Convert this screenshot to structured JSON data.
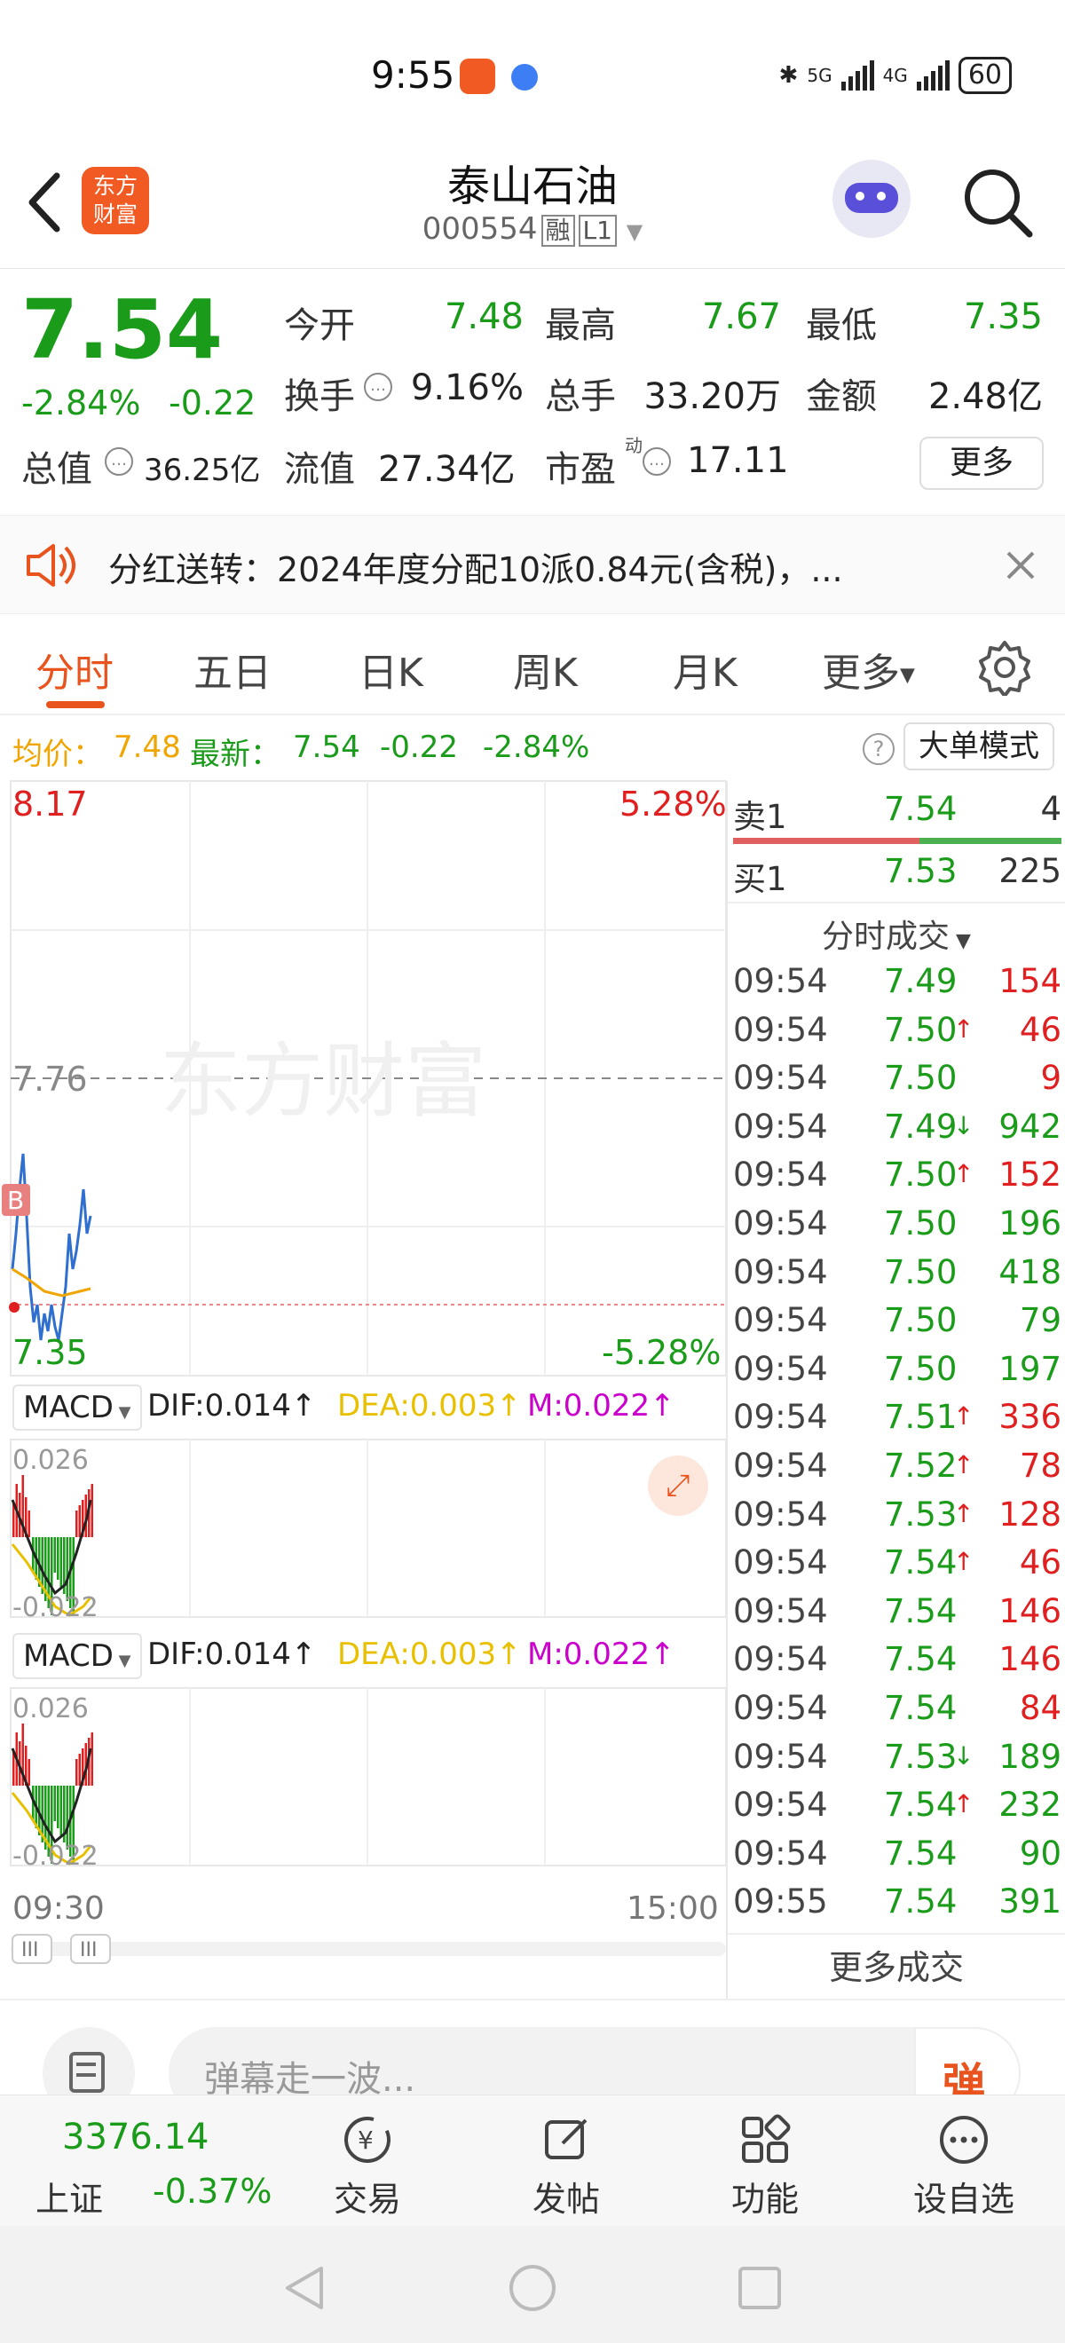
{
  "status_bar": {
    "time": "9:55",
    "network1": "5G",
    "network2": "4G",
    "battery": "60"
  },
  "header": {
    "title": "泰山石油",
    "code": "000554",
    "tag1": "融",
    "tag2": "L1",
    "logo_line1": "东方",
    "logo_line2": "财富"
  },
  "quote": {
    "price": "7.54",
    "change_pct": "-2.84%",
    "change": "-0.22",
    "open_label": "今开",
    "open": "7.48",
    "high_label": "最高",
    "high": "7.67",
    "low_label": "最低",
    "low": "7.35",
    "turnover_label": "换手",
    "turnover": "9.16%",
    "volume_label": "总手",
    "volume": "33.20万",
    "amount_label": "金额",
    "amount": "2.48亿",
    "mktcap_label": "总值",
    "mktcap": "36.25亿",
    "float_label": "流值",
    "float_cap": "27.34亿",
    "pe_label": "市盈",
    "pe_sup": "动",
    "pe": "17.11",
    "more": "更多"
  },
  "notice": {
    "text": "分红送转：2024年度分配10派0.84元(含税)，..."
  },
  "tabs": [
    "分时",
    "五日",
    "日K",
    "周K",
    "月K",
    "更多"
  ],
  "info_line": {
    "avg_label": "均价：",
    "avg": "7.48",
    "latest_label": "最新：",
    "latest": "7.54",
    "change": "-0.22",
    "change_pct": "-2.84%",
    "big_order_mode": "大单模式"
  },
  "chart": {
    "top_price": "8.17",
    "top_pct": "5.28%",
    "mid_price": "7.76",
    "bottom_price": "7.35",
    "bottom_pct": "-5.28%",
    "watermark": "东方财富",
    "buy_marker": "B",
    "time_start": "09:30",
    "time_end": "15:00"
  },
  "macd": [
    {
      "label": "MACD",
      "dif": "DIF:0.014↑",
      "dea": "DEA:0.003↑",
      "m": "M:0.022↑",
      "top": "0.026",
      "bottom": "-0.022"
    },
    {
      "label": "MACD",
      "dif": "DIF:0.014↑",
      "dea": "DEA:0.003↑",
      "m": "M:0.022↑",
      "top": "0.026",
      "bottom": "-0.022"
    }
  ],
  "orderbook": {
    "sell1": {
      "label": "卖1",
      "price": "7.54",
      "vol": "4"
    },
    "buy1": {
      "label": "买1",
      "price": "7.53",
      "vol": "225"
    }
  },
  "trades_title": "分时成交",
  "trades": [
    {
      "time": "09:54",
      "price": "7.49",
      "arrow": "",
      "vol": "154",
      "pc": "green",
      "vc": "red"
    },
    {
      "time": "09:54",
      "price": "7.50",
      "arrow": "↑",
      "vol": "46",
      "pc": "green",
      "vc": "red"
    },
    {
      "time": "09:54",
      "price": "7.50",
      "arrow": "",
      "vol": "9",
      "pc": "green",
      "vc": "red"
    },
    {
      "time": "09:54",
      "price": "7.49",
      "arrow": "↓",
      "vol": "942",
      "pc": "green",
      "vc": "green"
    },
    {
      "time": "09:54",
      "price": "7.50",
      "arrow": "↑",
      "vol": "152",
      "pc": "green",
      "vc": "red"
    },
    {
      "time": "09:54",
      "price": "7.50",
      "arrow": "",
      "vol": "196",
      "pc": "green",
      "vc": "green"
    },
    {
      "time": "09:54",
      "price": "7.50",
      "arrow": "",
      "vol": "418",
      "pc": "green",
      "vc": "green"
    },
    {
      "time": "09:54",
      "price": "7.50",
      "arrow": "",
      "vol": "79",
      "pc": "green",
      "vc": "green"
    },
    {
      "time": "09:54",
      "price": "7.50",
      "arrow": "",
      "vol": "197",
      "pc": "green",
      "vc": "green"
    },
    {
      "time": "09:54",
      "price": "7.51",
      "arrow": "↑",
      "vol": "336",
      "pc": "green",
      "vc": "red"
    },
    {
      "time": "09:54",
      "price": "7.52",
      "arrow": "↑",
      "vol": "78",
      "pc": "green",
      "vc": "red"
    },
    {
      "time": "09:54",
      "price": "7.53",
      "arrow": "↑",
      "vol": "128",
      "pc": "green",
      "vc": "red"
    },
    {
      "time": "09:54",
      "price": "7.54",
      "arrow": "↑",
      "vol": "46",
      "pc": "green",
      "vc": "red"
    },
    {
      "time": "09:54",
      "price": "7.54",
      "arrow": "",
      "vol": "146",
      "pc": "green",
      "vc": "red"
    },
    {
      "time": "09:54",
      "price": "7.54",
      "arrow": "",
      "vol": "146",
      "pc": "green",
      "vc": "red"
    },
    {
      "time": "09:54",
      "price": "7.54",
      "arrow": "",
      "vol": "84",
      "pc": "green",
      "vc": "red"
    },
    {
      "time": "09:54",
      "price": "7.53",
      "arrow": "↓",
      "vol": "189",
      "pc": "green",
      "vc": "green"
    },
    {
      "time": "09:54",
      "price": "7.54",
      "arrow": "↑",
      "vol": "232",
      "pc": "green",
      "vc": "green"
    },
    {
      "time": "09:54",
      "price": "7.54",
      "arrow": "",
      "vol": "90",
      "pc": "green",
      "vc": "green"
    },
    {
      "time": "09:55",
      "price": "7.54",
      "arrow": "",
      "vol": "391",
      "pc": "green",
      "vc": "green"
    }
  ],
  "more_trades": "更多成交",
  "danmu": {
    "placeholder": "弹幕走一波...",
    "button": "弹"
  },
  "bottom_nav": {
    "index_value": "3376.14",
    "index_name": "上证",
    "index_pct": "-0.37%",
    "items": [
      "交易",
      "发帖",
      "功能",
      "设自选"
    ]
  },
  "colors": {
    "accent": "#e8531e",
    "up": "#e02020",
    "down": "#1a9b1a",
    "avg": "#f0a500",
    "macd_dea": "#e8c000",
    "macd_m": "#cc00cc"
  }
}
